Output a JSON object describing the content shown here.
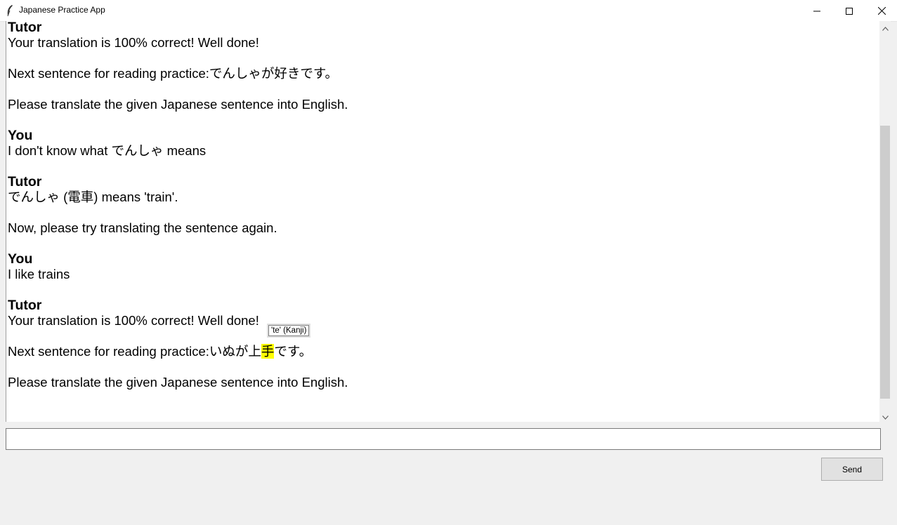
{
  "window": {
    "title": "Japanese Practice App"
  },
  "chat": {
    "lines": [
      {
        "kind": "speaker",
        "text": "Tutor"
      },
      {
        "kind": "text",
        "text": "Your translation is 100% correct! Well done!"
      },
      {
        "kind": "blank",
        "text": ""
      },
      {
        "kind": "text",
        "text": "Next sentence for reading practice:でんしゃが好きです。"
      },
      {
        "kind": "blank",
        "text": ""
      },
      {
        "kind": "text",
        "text": "Please translate the given Japanese sentence into English."
      },
      {
        "kind": "blank",
        "text": ""
      },
      {
        "kind": "speaker",
        "text": "You"
      },
      {
        "kind": "text",
        "text": "I don't know what でんしゃ means"
      },
      {
        "kind": "blank",
        "text": ""
      },
      {
        "kind": "speaker",
        "text": "Tutor"
      },
      {
        "kind": "text",
        "text": "でんしゃ (電車) means 'train'."
      },
      {
        "kind": "blank",
        "text": ""
      },
      {
        "kind": "text",
        "text": "Now, please try translating the sentence again."
      },
      {
        "kind": "blank",
        "text": ""
      },
      {
        "kind": "speaker",
        "text": "You"
      },
      {
        "kind": "text",
        "text": "I like trains"
      },
      {
        "kind": "blank",
        "text": ""
      },
      {
        "kind": "speaker",
        "text": "Tutor"
      },
      {
        "kind": "text",
        "text": "Your translation is 100% correct! Well done!"
      },
      {
        "kind": "blank",
        "text": ""
      },
      {
        "kind": "practice",
        "before": "Next sentence for reading practice:いぬが上",
        "highlight": "手",
        "after": "です。"
      },
      {
        "kind": "blank",
        "text": ""
      },
      {
        "kind": "text",
        "text": "Please translate the given Japanese sentence into English."
      }
    ],
    "tooltip": "'te' (Kanji)",
    "highlight_color": "#ffff00"
  },
  "input": {
    "value": "",
    "placeholder": ""
  },
  "send_button": {
    "label": "Send"
  },
  "scrollbar": {
    "thumb_start": 0.245,
    "thumb_end": 0.97
  },
  "icons": {
    "app": "feather-icon",
    "minimize": "minimize-icon",
    "maximize": "maximize-icon",
    "close": "close-icon",
    "scroll_up": "chevron-up-icon",
    "scroll_down": "chevron-down-icon"
  }
}
